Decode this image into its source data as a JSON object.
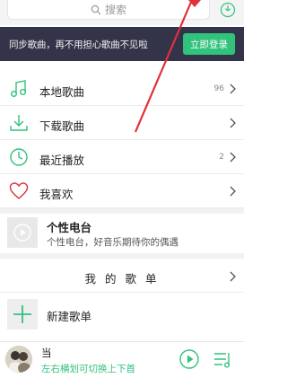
{
  "search": {
    "placeholder": "搜索",
    "icon": "search-icon"
  },
  "banner": {
    "text": "同步歌曲，再不用担心歌曲不见啦",
    "button_label": "立即登录",
    "accent": "#31c27c",
    "background": "#33334a"
  },
  "menu": [
    {
      "label": "本地歌曲",
      "count": "96",
      "icon": "music-note-icon"
    },
    {
      "label": "下载歌曲",
      "count": "",
      "icon": "download-icon"
    },
    {
      "label": "最近播放",
      "count": "2",
      "icon": "clock-icon"
    },
    {
      "label": "我喜欢",
      "count": "",
      "icon": "heart-icon"
    }
  ],
  "radio": {
    "title": "个性电台",
    "desc": "个性电台，好音乐期待你的偶遇"
  },
  "playlists": {
    "header": "我 的 歌 单",
    "new_label": "新建歌单"
  },
  "player": {
    "song": "当",
    "subtitle": "左右横划可切换上下首"
  },
  "annotation": {
    "color": "#e0303a"
  }
}
